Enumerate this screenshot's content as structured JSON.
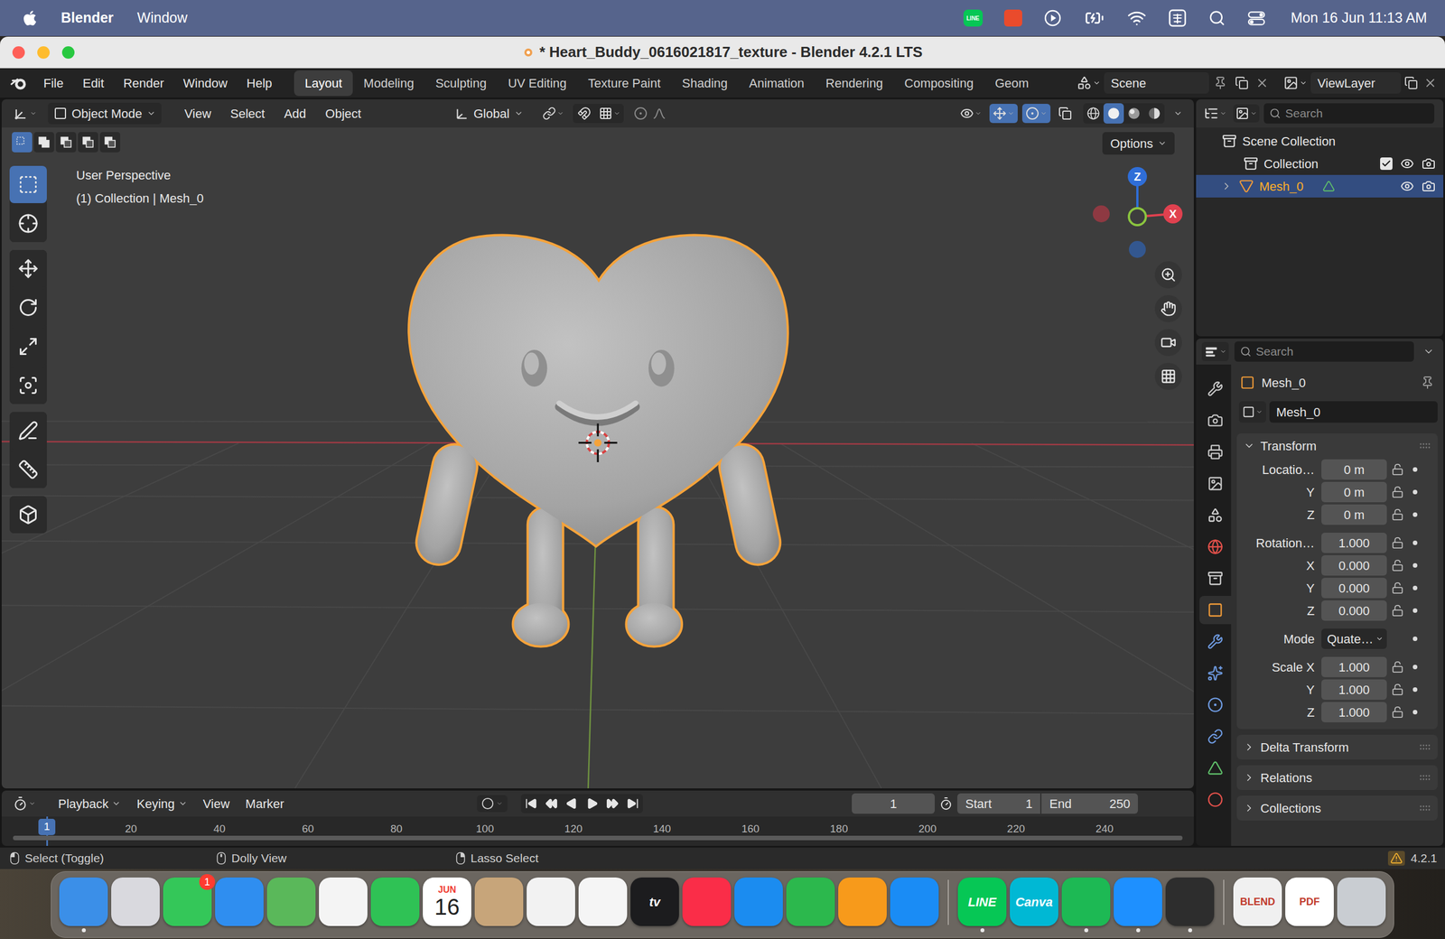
{
  "menubar": {
    "app": "Blender",
    "menus": [
      "Window"
    ],
    "tray": [
      {
        "kind": "line",
        "text": "LINE"
      },
      {
        "kind": "app"
      },
      {
        "kind": "play"
      },
      {
        "kind": "battery"
      },
      {
        "kind": "wifi"
      },
      {
        "kind": "input"
      },
      {
        "kind": "search"
      },
      {
        "kind": "control"
      }
    ],
    "clock": "Mon 16 Jun 11:13 AM"
  },
  "window": {
    "title": "* Heart_Buddy_0616021817_texture - Blender 4.2.1 LTS"
  },
  "topbar": {
    "menus": [
      "File",
      "Edit",
      "Render",
      "Window",
      "Help"
    ],
    "workspaces": [
      {
        "label": "Layout",
        "selected": true
      },
      {
        "label": "Modeling",
        "selected": false
      },
      {
        "label": "Sculpting",
        "selected": false
      },
      {
        "label": "UV Editing",
        "selected": false
      },
      {
        "label": "Texture Paint",
        "selected": false
      },
      {
        "label": "Shading",
        "selected": false
      },
      {
        "label": "Animation",
        "selected": false
      },
      {
        "label": "Rendering",
        "selected": false
      },
      {
        "label": "Compositing",
        "selected": false
      },
      {
        "label": "Geom",
        "selected": false
      }
    ],
    "scene": "Scene",
    "view_layer": "ViewLayer"
  },
  "viewport_header": {
    "mode": "Object Mode",
    "menus": [
      "View",
      "Select",
      "Add",
      "Object"
    ],
    "orientation": "Global",
    "gizmos": true,
    "overlays": true,
    "xray": false,
    "shading": [
      {
        "selected": false
      },
      {
        "selected": true
      },
      {
        "selected": false
      },
      {
        "selected": false
      }
    ]
  },
  "viewport": {
    "select_modes": [
      {
        "selected": true
      },
      {
        "selected": false
      },
      {
        "selected": false
      },
      {
        "selected": false
      },
      {
        "selected": false
      }
    ],
    "toolbar": [
      [
        {
          "selected": true
        },
        {
          "selected": false
        }
      ],
      [
        {
          "selected": false
        },
        {
          "selected": false
        },
        {
          "selected": false
        },
        {
          "selected": false
        }
      ],
      [
        {
          "selected": false
        },
        {
          "selected": false
        }
      ],
      [
        {
          "selected": false
        }
      ]
    ],
    "perspective": "User Perspective",
    "context": "(1) Collection | Mesh_0",
    "options": "Options",
    "axes": [
      "Z",
      "X"
    ]
  },
  "outliner": {
    "search": "Search",
    "items": [
      {
        "kind": "root",
        "label": "Scene Collection",
        "selected": false
      },
      {
        "kind": "collection",
        "label": "Collection",
        "selected": false,
        "checked": true,
        "visible": true,
        "renderable": true
      },
      {
        "kind": "object",
        "label": "Mesh_0",
        "selected": true,
        "expanded": false,
        "visible": true,
        "renderable": true
      }
    ]
  },
  "properties": {
    "search": "Search",
    "tabs": [
      {
        "selected": false
      },
      {
        "selected": false
      },
      {
        "selected": false
      },
      {
        "selected": false
      },
      {
        "selected": false
      },
      {
        "selected": false
      },
      {
        "selected": false
      },
      {
        "selected": true
      },
      {
        "selected": false
      },
      {
        "selected": false
      },
      {
        "selected": false
      },
      {
        "selected": false
      },
      {
        "selected": false
      },
      {
        "selected": false
      }
    ],
    "object_name": "Mesh_0",
    "data_name": "Mesh_0",
    "panels": [
      {
        "title": "Transform",
        "expanded": true,
        "groups": [
          {
            "rows": [
              {
                "label": "Locatio…",
                "value": "0 m",
                "kind": "field"
              },
              {
                "label": "Y",
                "value": "0 m",
                "kind": "field"
              },
              {
                "label": "Z",
                "value": "0 m",
                "kind": "field"
              }
            ]
          },
          {
            "rows": [
              {
                "label": "Rotation…",
                "value": "1.000",
                "kind": "field"
              },
              {
                "label": "X",
                "value": "0.000",
                "kind": "field"
              },
              {
                "label": "Y",
                "value": "0.000",
                "kind": "field"
              },
              {
                "label": "Z",
                "value": "0.000",
                "kind": "field"
              }
            ]
          },
          {
            "rows": [
              {
                "label": "Mode",
                "value": "Quate…",
                "kind": "dropdown"
              }
            ]
          },
          {
            "rows": [
              {
                "label": "Scale X",
                "value": "1.000",
                "kind": "field"
              },
              {
                "label": "Y",
                "value": "1.000",
                "kind": "field"
              },
              {
                "label": "Z",
                "value": "1.000",
                "kind": "field"
              }
            ]
          }
        ]
      },
      {
        "title": "Delta Transform",
        "expanded": false,
        "groups": []
      },
      {
        "title": "Relations",
        "expanded": false,
        "groups": []
      },
      {
        "title": "Collections",
        "expanded": false,
        "groups": []
      }
    ]
  },
  "timeline": {
    "menus": [
      {
        "label": "Playback",
        "dropdown": true
      },
      {
        "label": "Keying",
        "dropdown": true
      },
      {
        "label": "View",
        "dropdown": false
      },
      {
        "label": "Marker",
        "dropdown": false
      }
    ],
    "auto_key": false,
    "frame": "1",
    "start_label": "Start",
    "start": "1",
    "end_label": "End",
    "end": "250",
    "playhead": "1",
    "ticks": [
      "20",
      "40",
      "60",
      "80",
      "100",
      "120",
      "140",
      "160",
      "180",
      "200",
      "220",
      "240"
    ]
  },
  "status_bar": {
    "hints": [
      "Select (Toggle)",
      "Dolly View",
      "Lasso Select"
    ],
    "version": "4.2.1"
  },
  "dock": [
    [
      {
        "kind": "app",
        "color": "#3b8fe8",
        "running": true
      },
      {
        "kind": "app",
        "color": "#d9d9de",
        "running": false
      },
      {
        "kind": "app",
        "color": "#34c759",
        "running": false,
        "badge": "1"
      },
      {
        "kind": "app",
        "color": "#2f8ef0",
        "running": false
      },
      {
        "kind": "app",
        "color": "#5ab85a",
        "running": false
      },
      {
        "kind": "app",
        "color": "#f4f4f4",
        "running": false
      },
      {
        "kind": "app",
        "color": "#2fc255",
        "running": false
      },
      {
        "kind": "calendar",
        "color": "#ffffff",
        "running": false,
        "month": "JUN",
        "day": "16"
      },
      {
        "kind": "app",
        "color": "#c7a57a",
        "running": false
      },
      {
        "kind": "app",
        "color": "#f2f2f2",
        "running": false
      },
      {
        "kind": "app",
        "color": "#f5f5f5",
        "running": false
      },
      {
        "kind": "label",
        "color": "#1c1c1e",
        "running": false,
        "text": "tv"
      },
      {
        "kind": "app",
        "color": "#fa2d48",
        "running": false
      },
      {
        "kind": "app",
        "color": "#1b8cf0",
        "running": false
      },
      {
        "kind": "app",
        "color": "#2cb84d",
        "running": false
      },
      {
        "kind": "app",
        "color": "#f79a1b",
        "running": false
      },
      {
        "kind": "app",
        "color": "#1a8cf5",
        "running": false
      }
    ],
    [
      {
        "kind": "label",
        "color": "#06c755",
        "running": true,
        "text": "LINE"
      },
      {
        "kind": "label",
        "color": "#00b8d4",
        "running": false,
        "text": "Canva"
      },
      {
        "kind": "app",
        "color": "#1db954",
        "running": true
      },
      {
        "kind": "app",
        "color": "#1e90ff",
        "running": true
      },
      {
        "kind": "app",
        "color": "#2d2d2d",
        "running": true
      }
    ],
    [
      {
        "kind": "document",
        "color": "#f0f0f0",
        "running": false,
        "text": "BLEND"
      },
      {
        "kind": "document",
        "color": "#ffffff",
        "running": false,
        "text": "PDF"
      },
      {
        "kind": "app",
        "color": "#c9cdd2",
        "running": false
      }
    ]
  ]
}
